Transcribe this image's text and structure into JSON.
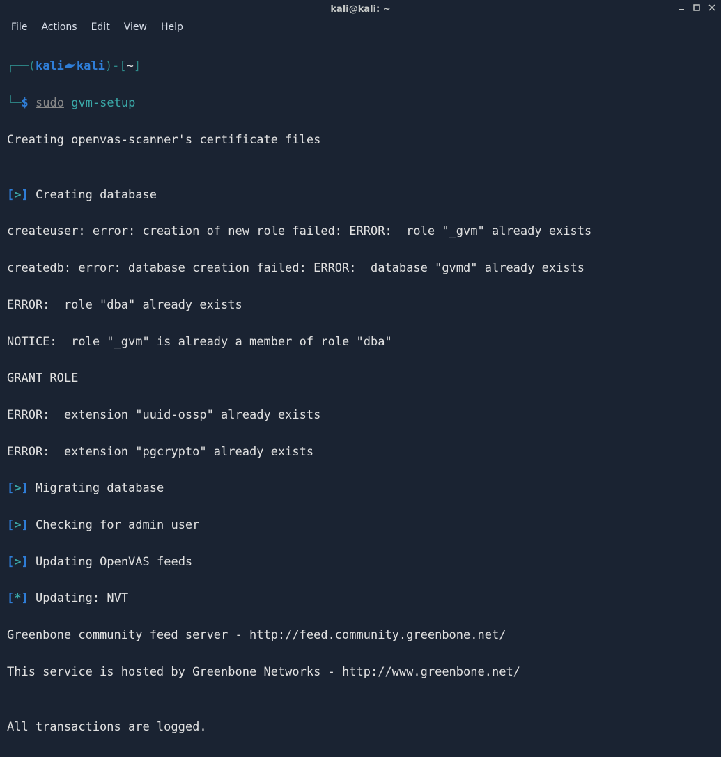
{
  "window": {
    "title": "kali@kali: ~"
  },
  "menubar": {
    "items": [
      "File",
      "Actions",
      "Edit",
      "View",
      "Help"
    ]
  },
  "prompt": {
    "user": "kali",
    "host": "kali",
    "path": "~",
    "dollar": "$",
    "sudo": "sudo",
    "command": "gvm-setup"
  },
  "output": {
    "l01": "Creating openvas-scanner's certificate files",
    "l02": "",
    "l03_label": "Creating database",
    "l04": "createuser: error: creation of new role failed: ERROR:  role \"_gvm\" already exists",
    "l05": "createdb: error: database creation failed: ERROR:  database \"gvmd\" already exists",
    "l06": "ERROR:  role \"dba\" already exists",
    "l07": "NOTICE:  role \"_gvm\" is already a member of role \"dba\"",
    "l08": "GRANT ROLE",
    "l09": "ERROR:  extension \"uuid-ossp\" already exists",
    "l10": "ERROR:  extension \"pgcrypto\" already exists",
    "l11_label": "Migrating database",
    "l12_label": "Checking for admin user",
    "l13_label": "Updating OpenVAS feeds",
    "l14_label": "Updating: NVT",
    "l15": "Greenbone community feed server - http://feed.community.greenbone.net/",
    "l16": "This service is hosted by Greenbone Networks - http://www.greenbone.net/",
    "l17": "",
    "l18": "All transactions are logged."
  },
  "markers": {
    "open": "[",
    "close": "]",
    "gt": ">",
    "star": "*"
  }
}
